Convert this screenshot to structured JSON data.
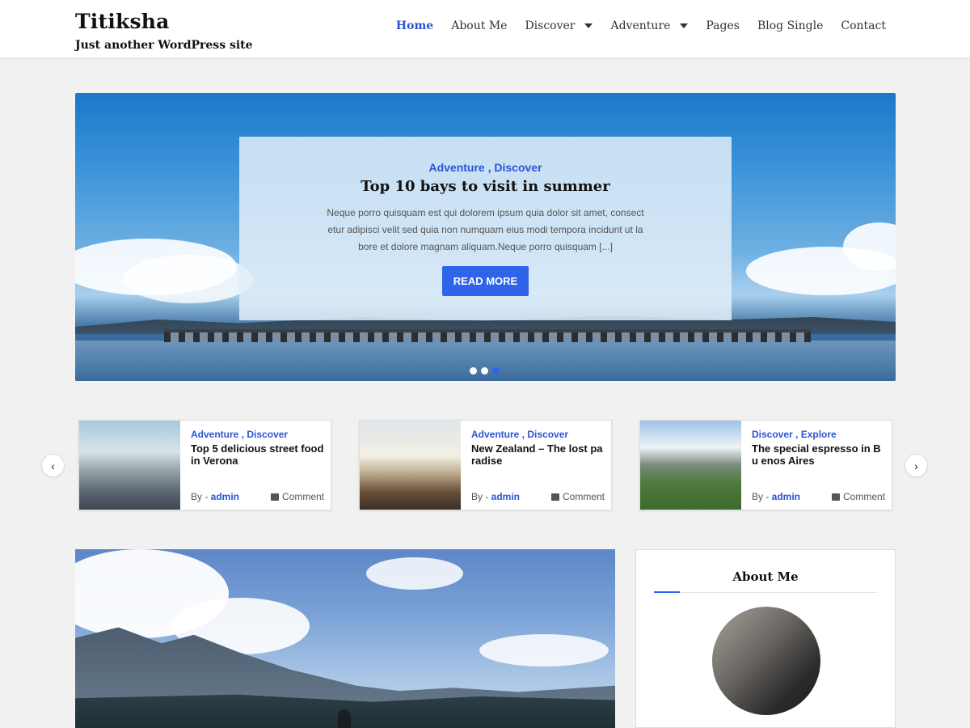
{
  "site": {
    "title": "Titiksha",
    "tagline": "Just another WordPress site"
  },
  "nav": {
    "items": [
      {
        "label": "Home",
        "active": true,
        "has_dropdown": false
      },
      {
        "label": "About Me",
        "active": false,
        "has_dropdown": false
      },
      {
        "label": "Discover",
        "active": false,
        "has_dropdown": true
      },
      {
        "label": "Adventure",
        "active": false,
        "has_dropdown": true
      },
      {
        "label": "Pages",
        "active": false,
        "has_dropdown": false
      },
      {
        "label": "Blog Single",
        "active": false,
        "has_dropdown": false
      },
      {
        "label": "Contact",
        "active": false,
        "has_dropdown": false
      }
    ]
  },
  "hero": {
    "categories": "Adventure , Discover",
    "title": "Top 10 bays to visit in summer",
    "excerpt": "Neque porro quisquam est qui dolorem ipsum quia dolor sit amet, consect etur adipisci velit sed quia non numquam eius modi tempora incidunt ut la bore et dolore magnam aliquam.Neque porro quisquam [...]",
    "button_label": "READ MORE",
    "slide_count": 3,
    "active_slide": 3
  },
  "posts": [
    {
      "categories": "Adventure , Discover",
      "title": "Top 5 delicious street food in Verona",
      "by_label": "By - ",
      "author": "admin",
      "comment_label": "Comment"
    },
    {
      "categories": "Adventure , Discover",
      "title": "New Zealand – The lost pa radise",
      "by_label": "By - ",
      "author": "admin",
      "comment_label": "Comment"
    },
    {
      "categories": "Discover , Explore",
      "title": "The special espresso in Bu enos Aires",
      "by_label": "By - ",
      "author": "admin",
      "comment_label": "Comment"
    }
  ],
  "carousel": {
    "prev_glyph": "‹",
    "next_glyph": "›"
  },
  "sidebar": {
    "widget_title": "About Me"
  },
  "colors": {
    "accent": "#2855d6",
    "button": "#2f63ea",
    "background": "#f1f1f1"
  }
}
